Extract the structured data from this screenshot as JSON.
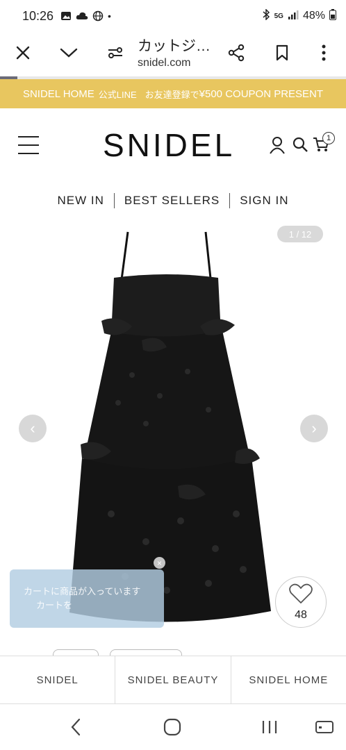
{
  "status_bar": {
    "time": "10:26",
    "dot": "•",
    "network": "5G",
    "battery": "48%"
  },
  "browser": {
    "page_title": "カットジ…",
    "domain": "snidel.com",
    "load_progress": 0.05
  },
  "promo_banner": {
    "part1": "SNIDEL HOME",
    "part2": "公式LINE",
    "part3": "お友達登録で",
    "part4": "¥500 COUPON PRESENT"
  },
  "header": {
    "logo": "SNIDEL",
    "cart_count": "1"
  },
  "nav": {
    "items": [
      "NEW IN",
      "BEST SELLERS",
      "SIGN IN"
    ]
  },
  "product": {
    "image_counter": "1 / 12",
    "prev_arrow": "‹",
    "next_arrow": "›",
    "toast_line1": "カートに商品が入っています",
    "toast_line2": "カートを",
    "toast_close": "×",
    "like_count": "48",
    "dress_color": "#1a1a1a"
  },
  "brand_tabs": [
    "SNIDEL",
    "SNIDEL BEAUTY",
    "SNIDEL HOME"
  ],
  "colors": {
    "promo": "#e8c65f",
    "toast": "#b2cde2"
  },
  "icons": [
    "close-icon",
    "chevron-down-icon",
    "site-settings-icon",
    "share-icon",
    "bookmark-icon",
    "more-icon",
    "user-icon",
    "search-icon",
    "cart-icon",
    "heart-icon",
    "back-icon",
    "home-icon",
    "recents-icon",
    "keyboard-icon"
  ]
}
